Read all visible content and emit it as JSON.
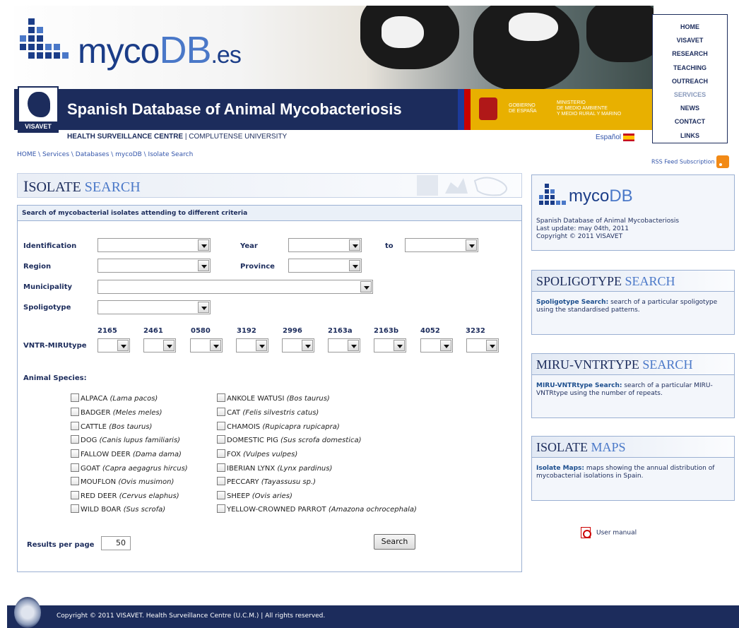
{
  "header": {
    "logo": {
      "prefix": "myco",
      "db": "DB",
      "suffix": ".es"
    },
    "site_title": "Spanish Database of Animal Mycobacteriosis",
    "visavet_label": "VISAVET",
    "subtitle_bold": "HEALTH SURVEILLANCE CENTRE",
    "subtitle_rest": " | COMPLUTENSE UNIVERSITY",
    "gov_left": "GOBIERNO\nDE ESPAÑA",
    "gov_right": "MINISTERIO\nDE MEDIO AMBIENTE\nY MEDIO RURAL Y MARINO",
    "language": "Español"
  },
  "nav": [
    "HOME",
    "VISAVET",
    "RESEARCH",
    "TEACHING",
    "OUTREACH",
    "SERVICES",
    "NEWS",
    "CONTACT",
    "LINKS"
  ],
  "nav_active": "SERVICES",
  "breadcrumb": "HOME \\ Services \\ Databases \\ mycoDB \\ Isolate Search",
  "rss": "RSS Feed Subscription",
  "main": {
    "title_initial": "I",
    "title_word1": "SOLATE ",
    "title_word2": "SEARCH",
    "panel_heading": "Search of mycobacterial isolates attending to different criteria",
    "labels": {
      "identification": "Identification",
      "year": "Year",
      "to": "to",
      "region": "Region",
      "province": "Province",
      "municipality": "Municipality",
      "spoligotype": "Spoligotype",
      "vntr": "VNTR-MIRUtype",
      "animal_species": "Animal Species:",
      "results_per_page": "Results per page"
    },
    "vntr_loci": [
      "2165",
      "2461",
      "0580",
      "3192",
      "2996",
      "2163a",
      "2163b",
      "4052",
      "3232"
    ],
    "species_left": [
      {
        "name": "ALPACA",
        "latin": "(Lama pacos)"
      },
      {
        "name": "BADGER",
        "latin": "(Meles meles)"
      },
      {
        "name": "CATTLE",
        "latin": "(Bos taurus)"
      },
      {
        "name": "DOG",
        "latin": "(Canis lupus familiaris)"
      },
      {
        "name": "FALLOW DEER",
        "latin": "(Dama dama)"
      },
      {
        "name": "GOAT",
        "latin": "(Capra aegagrus hircus)"
      },
      {
        "name": "MOUFLON",
        "latin": "(Ovis musimon)"
      },
      {
        "name": "RED DEER",
        "latin": "(Cervus elaphus)"
      },
      {
        "name": "WILD BOAR",
        "latin": "(Sus scrofa)"
      }
    ],
    "species_right": [
      {
        "name": "ANKOLE WATUSI",
        "latin": "(Bos taurus)"
      },
      {
        "name": "CAT",
        "latin": "(Felis silvestris catus)"
      },
      {
        "name": "CHAMOIS",
        "latin": "(Rupicapra rupicapra)"
      },
      {
        "name": "DOMESTIC PIG",
        "latin": "(Sus scrofa domestica)"
      },
      {
        "name": "FOX",
        "latin": "(Vulpes vulpes)"
      },
      {
        "name": "IBERIAN LYNX",
        "latin": "(Lynx pardinus)"
      },
      {
        "name": "PECCARY",
        "latin": "(Tayassusu sp.)"
      },
      {
        "name": "SHEEP",
        "latin": "(Ovis aries)"
      },
      {
        "name": "YELLOW-CROWNED PARROT",
        "latin": "(Amazona ochrocephala)"
      }
    ],
    "results_per_page_value": "50",
    "search_button": "Search"
  },
  "sidebar": {
    "mycodb": {
      "logo_prefix": "myco",
      "logo_db": "DB",
      "line1": "Spanish Database of Animal Mycobacteriosis",
      "line2": "Last update: may 04th, 2011",
      "line3": "Copyright © 2011 VISAVET"
    },
    "boxes": [
      {
        "id": "spoligotype",
        "title_a": "SPOLIGOTYPE ",
        "title_b": "SEARCH",
        "bold": "Spoligotype Search:",
        "text": " search of a particular spoligotype using the standardised patterns."
      },
      {
        "id": "miru",
        "title_a": "MIRU-VNTRTYPE ",
        "title_b": "SEARCH",
        "bold": "MIRU-VNTRtype Search:",
        "text": " search of a particular MIRU-VNTRtype using the number of repeats."
      },
      {
        "id": "maps",
        "title_a": "ISOLATE ",
        "title_b": "MAPS",
        "bold": "Isolate Maps:",
        "text": " maps showing the annual distribution of mycobacterial isolations in Spain."
      }
    ],
    "manual": "User manual"
  },
  "footer": "Copyright © 2011 VISAVET. Health Surveillance Centre (U.C.M.) | All rights reserved.",
  "colors": {
    "navy": "#1c2c5c",
    "accent": "#4a78c8",
    "gov_yellow": "#e8b000"
  }
}
